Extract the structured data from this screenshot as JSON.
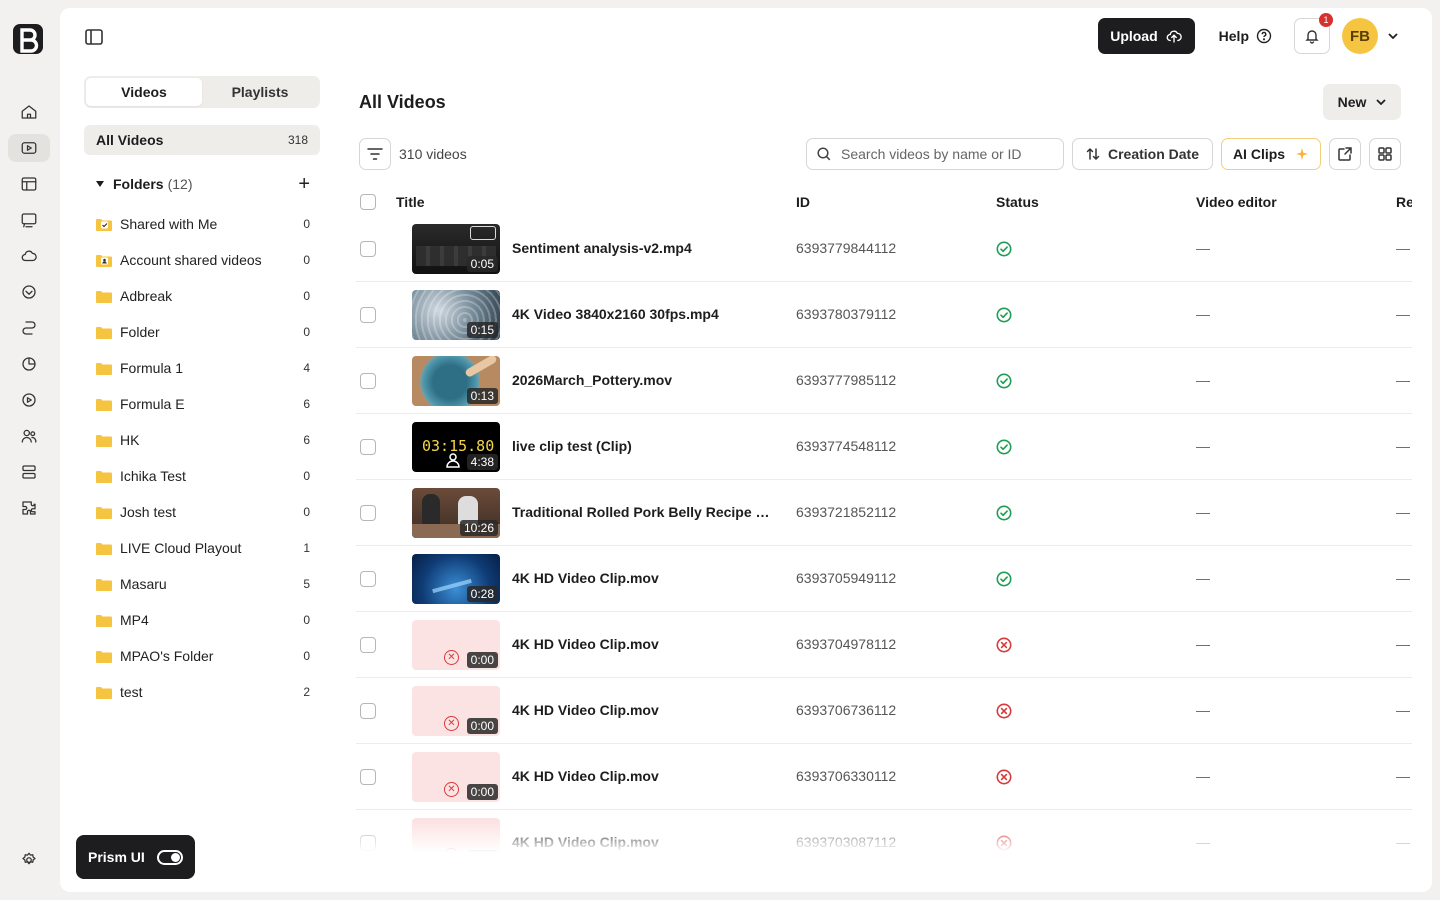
{
  "header": {
    "upload_label": "Upload",
    "help_label": "Help",
    "notification_count": "1",
    "avatar_initials": "FB"
  },
  "sidebar": {
    "tabs": [
      {
        "label": "Videos",
        "active": true
      },
      {
        "label": "Playlists",
        "active": false
      }
    ],
    "all_videos": {
      "label": "All Videos",
      "count": "318"
    },
    "folders_label": "Folders",
    "folders_count": "(12)",
    "folders": [
      {
        "name": "Shared with Me",
        "count": "0",
        "type": "shared"
      },
      {
        "name": "Account shared videos",
        "count": "0",
        "type": "account"
      },
      {
        "name": "Adbreak",
        "count": "0",
        "type": "folder"
      },
      {
        "name": "Folder",
        "count": "0",
        "type": "folder"
      },
      {
        "name": "Formula 1",
        "count": "4",
        "type": "folder"
      },
      {
        "name": "Formula E",
        "count": "6",
        "type": "folder"
      },
      {
        "name": "HK",
        "count": "6",
        "type": "folder"
      },
      {
        "name": "Ichika Test",
        "count": "0",
        "type": "folder"
      },
      {
        "name": "Josh test",
        "count": "0",
        "type": "folder"
      },
      {
        "name": "LIVE Cloud Playout",
        "count": "1",
        "type": "folder"
      },
      {
        "name": "Masaru",
        "count": "5",
        "type": "folder"
      },
      {
        "name": "MP4",
        "count": "0",
        "type": "folder"
      },
      {
        "name": "MPAO's Folder",
        "count": "0",
        "type": "folder"
      },
      {
        "name": "test",
        "count": "2",
        "type": "folder"
      }
    ],
    "prism_label": "Prism UI"
  },
  "main": {
    "title": "All Videos",
    "new_label": "New",
    "video_count_text": "310 videos",
    "search_placeholder": "Search videos by name or ID",
    "sort_label": "Creation Date",
    "ai_clips_label": "AI Clips",
    "columns": [
      "Title",
      "ID",
      "Status",
      "Video editor",
      "Re"
    ],
    "rows": [
      {
        "title": "Sentiment analysis-v2.mp4",
        "id": "6393779844112",
        "status": "ok",
        "duration": "0:05",
        "editor": "—",
        "thumb": "dark-ui"
      },
      {
        "title": "4K Video 3840x2160 30fps.mp4",
        "id": "6393780379112",
        "status": "ok",
        "duration": "0:15",
        "editor": "—",
        "thumb": "water"
      },
      {
        "title": "2026March_Pottery.mov",
        "id": "6393777985112",
        "status": "ok",
        "duration": "0:13",
        "editor": "—",
        "thumb": "pottery"
      },
      {
        "title": "live clip test (Clip)",
        "id": "6393774548112",
        "status": "ok",
        "duration": "4:38",
        "editor": "—",
        "thumb": "timer",
        "thumb_text": "03:15.80"
      },
      {
        "title": "Traditional Rolled Pork Belly Recipe wi...",
        "id": "6393721852112",
        "status": "ok",
        "duration": "10:26",
        "editor": "—",
        "thumb": "cooking"
      },
      {
        "title": "4K HD Video Clip.mov",
        "id": "6393705949112",
        "status": "ok",
        "duration": "0:28",
        "editor": "—",
        "thumb": "blue"
      },
      {
        "title": "4K HD Video Clip.mov",
        "id": "6393704978112",
        "status": "error",
        "duration": "0:00",
        "editor": "—",
        "thumb": "error"
      },
      {
        "title": "4K HD Video Clip.mov",
        "id": "6393706736112",
        "status": "error",
        "duration": "0:00",
        "editor": "—",
        "thumb": "error"
      },
      {
        "title": "4K HD Video Clip.mov",
        "id": "6393706330112",
        "status": "error",
        "duration": "0:00",
        "editor": "—",
        "thumb": "error"
      },
      {
        "title": "4K HD Video Clip.mov",
        "id": "6393703087112",
        "status": "error",
        "duration": "0:00",
        "editor": "—",
        "thumb": "error"
      }
    ]
  },
  "colors": {
    "ok": "#1f9d55",
    "error": "#d63a3a",
    "accent_avatar": "#f5c542",
    "folder": "#f5c542"
  }
}
